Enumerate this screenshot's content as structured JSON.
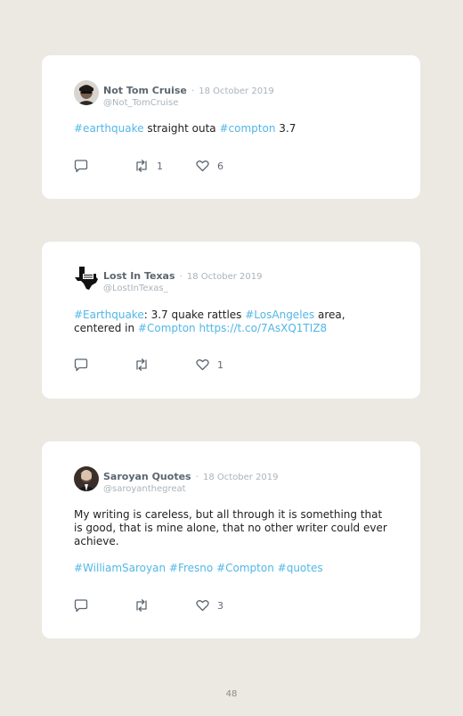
{
  "tweets": [
    {
      "name": "Not Tom Cruise",
      "date": "18 October 2019",
      "handle": "@Not_TomCruise",
      "text": [
        {
          "t": "#earthquake",
          "link": true
        },
        {
          "t": " straight outa ",
          "link": false
        },
        {
          "t": "#compton",
          "link": true
        },
        {
          "t": " 3.7",
          "link": false
        }
      ],
      "retweets": "1",
      "likes": "6"
    },
    {
      "name": "Lost In Texas",
      "date": "18 October 2019",
      "handle": "@LostInTexas_",
      "text": [
        {
          "t": "#Earthquake",
          "link": true
        },
        {
          "t": ": 3.7 quake rattles ",
          "link": false
        },
        {
          "t": "#LosAngeles",
          "link": true
        },
        {
          "t": " area, centered in ",
          "link": false
        },
        {
          "t": "#Compton",
          "link": true
        },
        {
          "t": " ",
          "link": false
        },
        {
          "t": "https://t.co/7AsXQ1TIZ8",
          "link": true
        }
      ],
      "retweets": "",
      "likes": "1"
    },
    {
      "name": "Saroyan Quotes",
      "date": "18 October 2019",
      "handle": "@saroyanthegreat",
      "text": [
        {
          "t": "My writing is careless, but all through it is something that is good, that is mine alone, that no other writer could ever achieve.",
          "link": false
        }
      ],
      "hashtags": [
        {
          "t": "#WilliamSaroyan",
          "link": true
        },
        {
          "t": " ",
          "link": false
        },
        {
          "t": "#Fresno",
          "link": true
        },
        {
          "t": " ",
          "link": false
        },
        {
          "t": "#Compton",
          "link": true
        },
        {
          "t": " ",
          "link": false
        },
        {
          "t": "#quotes",
          "link": true
        }
      ],
      "retweets": "",
      "likes": "3"
    }
  ],
  "page_number": "48",
  "colors": {
    "link": "#52b7e6",
    "background": "#ece9e3",
    "card": "#ffffff"
  },
  "icons": {
    "reply": "speech-bubble-icon",
    "retweet": "retweet-arrows-icon",
    "like": "heart-outline-icon"
  }
}
